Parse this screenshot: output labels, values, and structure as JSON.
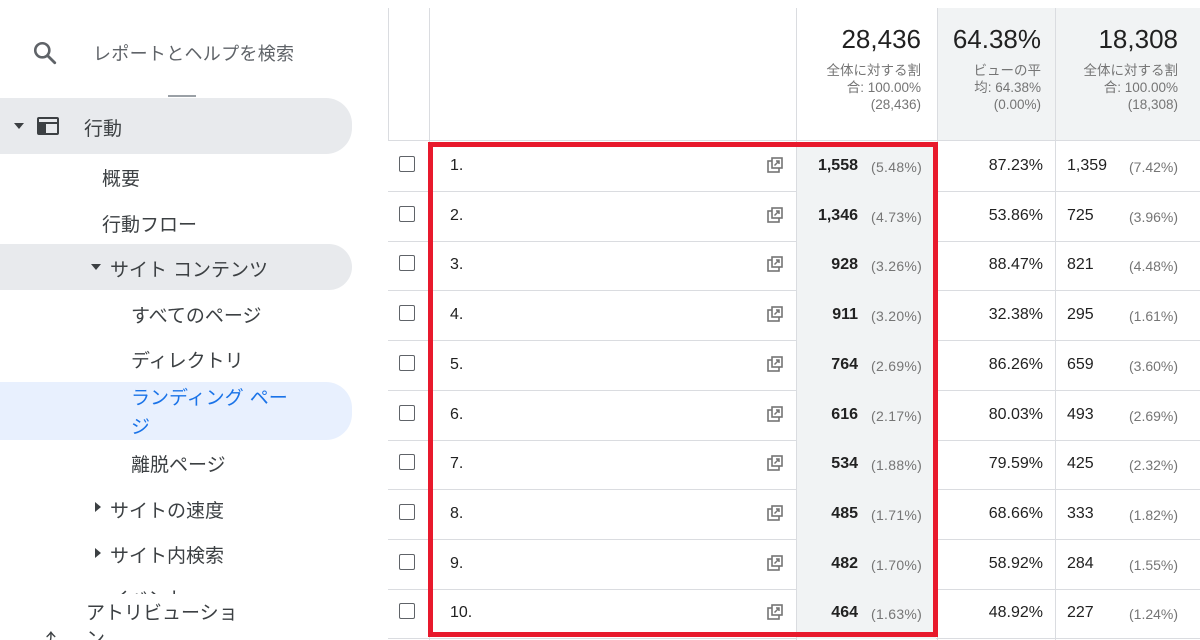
{
  "search": {
    "label": "レポートとヘルプを検索"
  },
  "nav": {
    "behavior": "行動",
    "overview": "概要",
    "behavior_flow": "行動フロー",
    "site_content": "サイト コンテンツ",
    "all_pages": "すべてのページ",
    "directory": "ディレクトリ",
    "landing_line1": "ランディング ペー",
    "landing_line2": "ジ",
    "exit_pages": "離脱ページ",
    "site_speed": "サイトの速度",
    "site_search": "サイト内検索",
    "events_partial": "イベント",
    "attribution_line1": "アトリビューショ",
    "attribution_line2": "ン"
  },
  "totals": {
    "sessions": {
      "value": "28,436",
      "line1": "全体に対する割",
      "line2": "合: 100.00%",
      "line3": "(28,436)"
    },
    "percent": {
      "value": "64.38%",
      "line1": "ビューの平",
      "line2": "均: 64.38%",
      "line3": "(0.00%)"
    },
    "new": {
      "value": "18,308",
      "line1": "全体に対する割",
      "line2": "合: 100.00%",
      "line3": "(18,308)"
    }
  },
  "rows": [
    {
      "num": "1.",
      "sessions": "1,558",
      "sessions_pct": "(5.48%)",
      "pct": "87.23%",
      "new": "1,359",
      "new_pct": "(7.42%)"
    },
    {
      "num": "2.",
      "sessions": "1,346",
      "sessions_pct": "(4.73%)",
      "pct": "53.86%",
      "new": "725",
      "new_pct": "(3.96%)"
    },
    {
      "num": "3.",
      "sessions": "928",
      "sessions_pct": "(3.26%)",
      "pct": "88.47%",
      "new": "821",
      "new_pct": "(4.48%)"
    },
    {
      "num": "4.",
      "sessions": "911",
      "sessions_pct": "(3.20%)",
      "pct": "32.38%",
      "new": "295",
      "new_pct": "(1.61%)"
    },
    {
      "num": "5.",
      "sessions": "764",
      "sessions_pct": "(2.69%)",
      "pct": "86.26%",
      "new": "659",
      "new_pct": "(3.60%)"
    },
    {
      "num": "6.",
      "sessions": "616",
      "sessions_pct": "(2.17%)",
      "pct": "80.03%",
      "new": "493",
      "new_pct": "(2.69%)"
    },
    {
      "num": "7.",
      "sessions": "534",
      "sessions_pct": "(1.88%)",
      "pct": "79.59%",
      "new": "425",
      "new_pct": "(2.32%)"
    },
    {
      "num": "8.",
      "sessions": "485",
      "sessions_pct": "(1.71%)",
      "pct": "68.66%",
      "new": "333",
      "new_pct": "(1.82%)"
    },
    {
      "num": "9.",
      "sessions": "482",
      "sessions_pct": "(1.70%)",
      "pct": "58.92%",
      "new": "284",
      "new_pct": "(1.55%)"
    },
    {
      "num": "10.",
      "sessions": "464",
      "sessions_pct": "(1.63%)",
      "pct": "48.92%",
      "new": "227",
      "new_pct": "(1.24%)"
    }
  ],
  "colors": {
    "highlight": "#e8192c",
    "active_bg": "#e8f0fe",
    "active_text": "#1a73e8",
    "header_bg": "#f1f3f4"
  },
  "icons": {
    "search": "search-icon",
    "behavior": "behavior-icon",
    "external_link": "external-link-icon",
    "attribution": "attribution-icon"
  }
}
